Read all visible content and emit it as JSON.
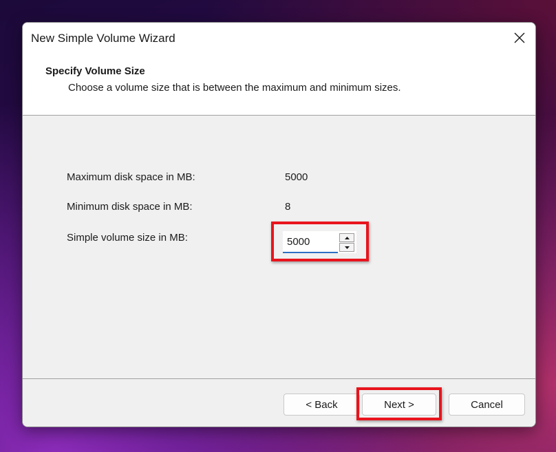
{
  "window": {
    "title": "New Simple Volume Wizard",
    "close_icon": "close-icon"
  },
  "header": {
    "title": "Specify Volume Size",
    "subtitle": "Choose a volume size that is between the maximum and minimum sizes."
  },
  "fields": {
    "max_label": "Maximum disk space in MB:",
    "max_value": "5000",
    "min_label": "Minimum disk space in MB:",
    "min_value": "8",
    "size_label": "Simple volume size in MB:",
    "size_value": "5000"
  },
  "buttons": {
    "back": "< Back",
    "next": "Next >",
    "cancel": "Cancel"
  },
  "colors": {
    "highlight": "#e8141c",
    "input_underline": "#2b6fc2"
  }
}
